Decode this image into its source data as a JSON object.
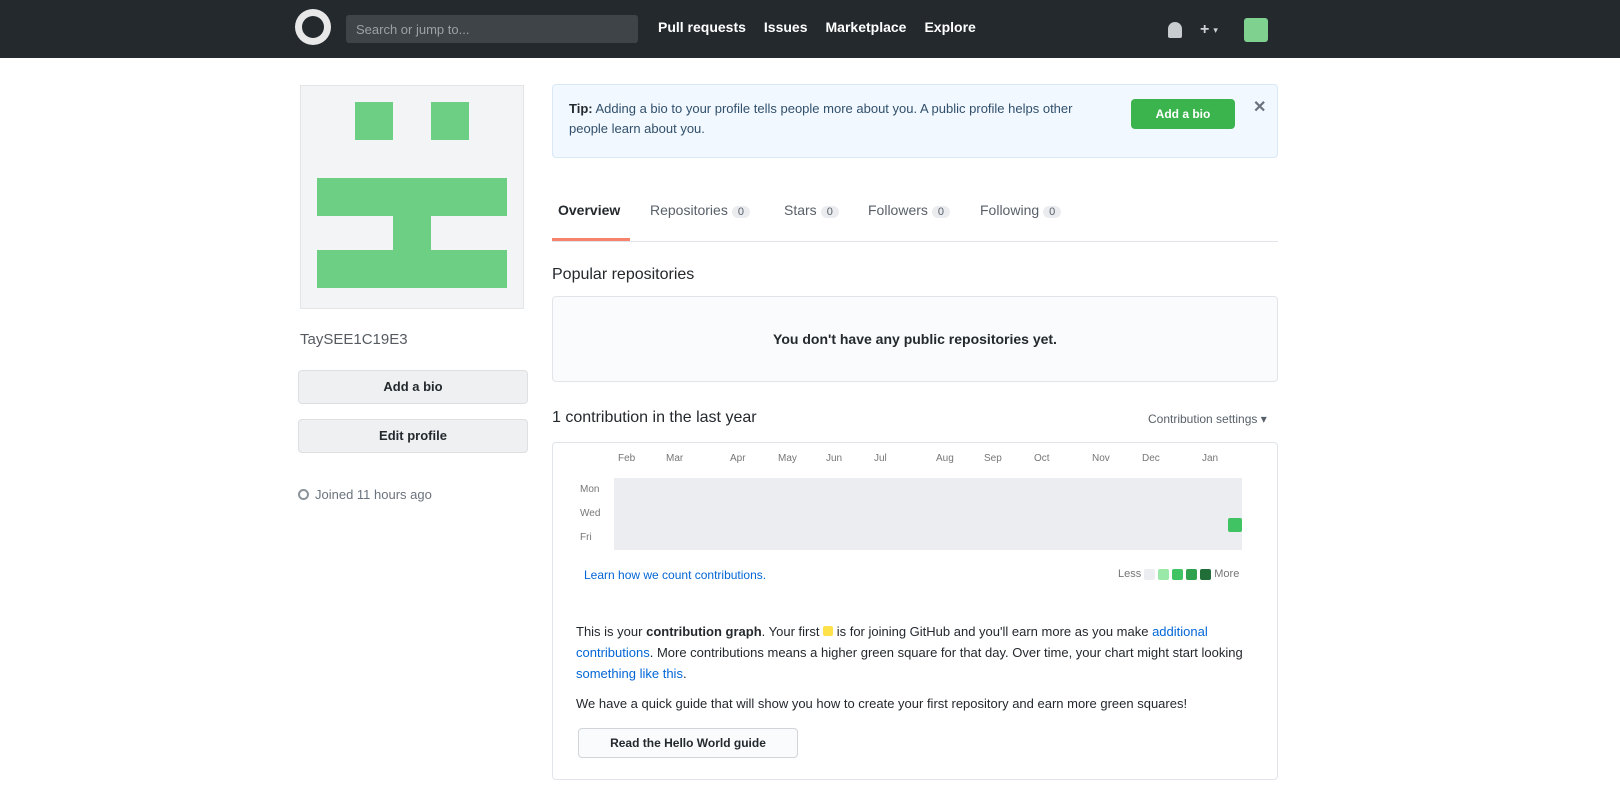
{
  "header": {
    "search_placeholder": "Search or jump to...",
    "nav": [
      "Pull requests",
      "Issues",
      "Marketplace",
      "Explore"
    ],
    "plus": "+",
    "caret": "▾"
  },
  "sidebar": {
    "username": "TaySEE1C19E3",
    "add_bio": "Add a bio",
    "edit_profile": "Edit profile",
    "joined": "Joined 11 hours ago"
  },
  "banner": {
    "lead": "Tip:",
    "text": "Adding a bio to your profile tells people more about you. A public profile helps other people learn about you.",
    "button": "Add a bio",
    "close": "✕"
  },
  "tabs": [
    {
      "label": "Overview",
      "count": ""
    },
    {
      "label": "Repositories",
      "count": "0"
    },
    {
      "label": "Stars",
      "count": "0"
    },
    {
      "label": "Followers",
      "count": "0"
    },
    {
      "label": "Following",
      "count": "0"
    }
  ],
  "popular": {
    "title": "Popular repositories",
    "empty": "You don't have any public repositories yet."
  },
  "contributions": {
    "title": "1 contribution in the last year",
    "settings": "Contribution settings ▾",
    "months": [
      "Feb",
      "Mar",
      "Apr",
      "May",
      "Jun",
      "Jul",
      "Aug",
      "Sep",
      "Oct",
      "Nov",
      "Dec",
      "Jan"
    ],
    "days": [
      "Mon",
      "Wed",
      "Fri"
    ],
    "learn": "Learn how we count contributions.",
    "less": "Less",
    "more": "More",
    "colors": [
      "#ebedf0",
      "#9be9a8",
      "#40c463",
      "#30a14e",
      "#216e39"
    ]
  },
  "guide": {
    "line1_a": "This is your",
    "line1_b": "contribution graph",
    "line1_c": ". Your first",
    "line1_d": "is for joining GitHub and you'll earn more as you make",
    "link1": "additional contributions",
    "line2": ". More contributions means a higher green square for that day. Over time, your chart might start looking",
    "link2": "something like this",
    "line3": ".",
    "line4": "We have a quick guide that will show you how to create your first repository and earn more green squares!",
    "button": "Read the Hello World guide"
  }
}
